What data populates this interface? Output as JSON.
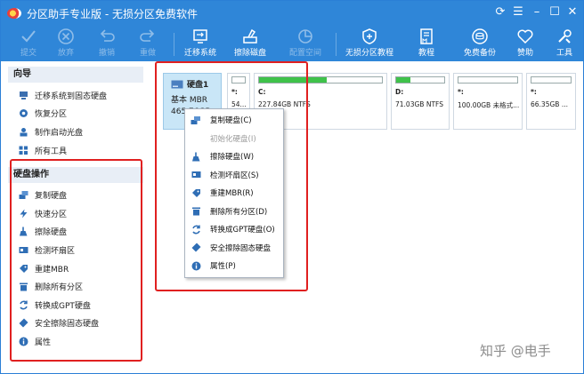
{
  "window": {
    "title": "分区助手专业版 - 无损分区免费软件"
  },
  "toolbar": {
    "buttons": [
      {
        "label": "提交",
        "icon": "check-icon",
        "enabled": false
      },
      {
        "label": "放弃",
        "icon": "cancel-circle-icon",
        "enabled": false
      },
      {
        "label": "撤销",
        "icon": "undo-icon",
        "enabled": false
      },
      {
        "label": "重做",
        "icon": "redo-icon",
        "enabled": false
      },
      {
        "label": "迁移系统",
        "icon": "migrate-os-icon",
        "enabled": true
      },
      {
        "label": "擦除磁盘",
        "icon": "wipe-disk-icon",
        "enabled": true
      },
      {
        "label": "配置空间",
        "icon": "allocate-space-icon",
        "enabled": false
      },
      {
        "label": "无损分区教程",
        "icon": "shield-icon",
        "enabled": true
      },
      {
        "label": "教程",
        "icon": "book-icon",
        "enabled": true
      },
      {
        "label": "免费备份",
        "icon": "backup-icon",
        "enabled": true
      },
      {
        "label": "赞助",
        "icon": "heart-icon",
        "enabled": true
      },
      {
        "label": "工具",
        "icon": "tools-icon",
        "enabled": true
      }
    ]
  },
  "sidebar": {
    "wizard_header": "向导",
    "wizard_items": [
      {
        "label": "迁移系统到固态硬盘",
        "icon": "migrate-ssd-icon"
      },
      {
        "label": "恢复分区",
        "icon": "recover-partition-icon"
      },
      {
        "label": "制作启动光盘",
        "icon": "boot-disc-icon"
      },
      {
        "label": "所有工具",
        "icon": "all-tools-icon"
      }
    ],
    "disk_ops_header": "硬盘操作",
    "disk_ops_items": [
      {
        "label": "复制硬盘",
        "icon": "copy-disk-icon"
      },
      {
        "label": "快速分区",
        "icon": "quick-partition-icon"
      },
      {
        "label": "擦除硬盘",
        "icon": "wipe-disk-icon"
      },
      {
        "label": "检测坏扇区",
        "icon": "bad-sector-icon"
      },
      {
        "label": "重建MBR",
        "icon": "rebuild-mbr-icon"
      },
      {
        "label": "删除所有分区",
        "icon": "delete-partitions-icon"
      },
      {
        "label": "转换成GPT硬盘",
        "icon": "convert-gpt-icon"
      },
      {
        "label": "安全擦除固态硬盘",
        "icon": "secure-erase-icon"
      },
      {
        "label": "属性",
        "icon": "info-icon"
      }
    ]
  },
  "disk": {
    "name": "硬盘1",
    "type": "基本 MBR",
    "size": "465.76GB"
  },
  "partitions": [
    {
      "letter": "*:",
      "size": "54...",
      "fs": "",
      "used_fraction": 0.0
    },
    {
      "letter": "C:",
      "size": "227.84GB",
      "fs": "NTFS",
      "used_fraction": 0.55
    },
    {
      "letter": "D:",
      "size": "71.03GB",
      "fs": "NTFS",
      "used_fraction": 0.3
    },
    {
      "letter": "*:",
      "size": "100.00GB",
      "fs": "未格式...",
      "used_fraction": 0.0
    },
    {
      "letter": "*:",
      "size": "66.35GB",
      "fs": "...",
      "used_fraction": 0.0
    }
  ],
  "context_menu": {
    "items": [
      {
        "label": "复制硬盘(C)",
        "icon": "copy-disk-icon",
        "enabled": true
      },
      {
        "label": "初始化硬盘(I)",
        "icon": "",
        "enabled": false
      },
      {
        "label": "擦除硬盘(W)",
        "icon": "wipe-disk-icon",
        "enabled": true
      },
      {
        "label": "检测坏扇区(S)",
        "icon": "bad-sector-icon",
        "enabled": true
      },
      {
        "label": "重建MBR(R)",
        "icon": "rebuild-mbr-icon",
        "enabled": true
      },
      {
        "label": "删除所有分区(D)",
        "icon": "delete-partitions-icon",
        "enabled": true
      },
      {
        "label": "转换成GPT硬盘(O)",
        "icon": "convert-gpt-icon",
        "enabled": true
      },
      {
        "label": "安全擦除固态硬盘",
        "icon": "secure-erase-icon",
        "enabled": true
      },
      {
        "label": "属性(P)",
        "icon": "info-icon",
        "enabled": true
      }
    ]
  },
  "watermark": "知乎 @电手",
  "colors": {
    "titlebar": "#2f86d8",
    "highlight": "#e02020",
    "disk_card": "#c9e6f7",
    "used_bar": "#3fc24a"
  }
}
